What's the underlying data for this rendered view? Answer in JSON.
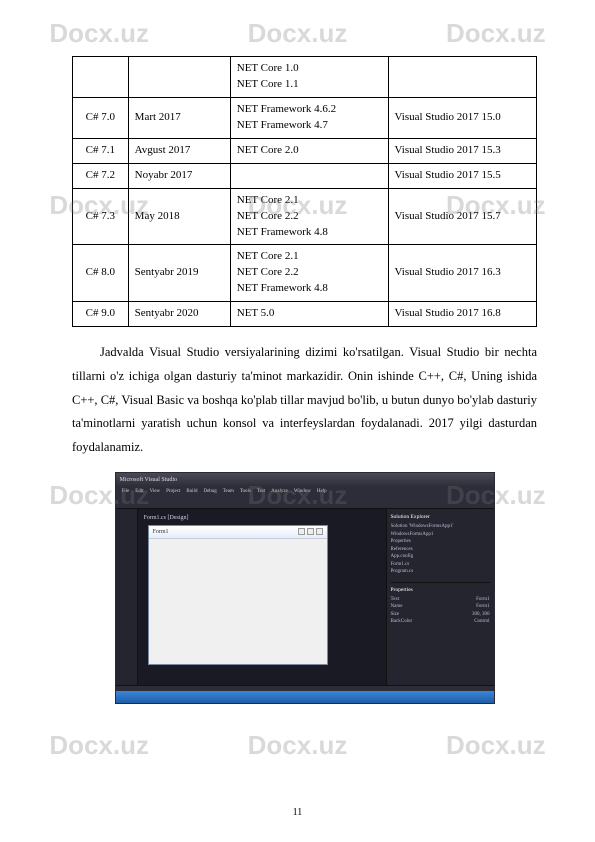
{
  "watermark": "Docx.uz",
  "table": {
    "rows": [
      {
        "ver": "",
        "date": "",
        "net": "NET Core 1.0\nNET Core 1.1",
        "vs": ""
      },
      {
        "ver": "C# 7.0",
        "date": "Mart 2017",
        "net": "NET Framework 4.6.2\nNET Framework 4.7",
        "vs": "Visual Studio 2017 15.0"
      },
      {
        "ver": "C# 7.1",
        "date": "Avgust 2017",
        "net": "NET Core 2.0",
        "vs": "Visual Studio 2017 15.3"
      },
      {
        "ver": "C# 7.2",
        "date": "Noyabr 2017",
        "net": "",
        "vs": "Visual Studio 2017 15.5"
      },
      {
        "ver": "C# 7.3",
        "date": "May 2018",
        "net": "NET Core 2.1\nNET Core 2.2\nNET Framework 4.8",
        "vs": "Visual Studio 2017 15.7"
      },
      {
        "ver": "C# 8.0",
        "date": "Sentyabr 2019",
        "net": "NET Core 2.1\nNET Core 2.2\nNET Framework 4.8",
        "vs": "Visual Studio 2017 16.3"
      },
      {
        "ver": "C# 9.0",
        "date": "Sentyabr 2020",
        "net": "NET 5.0",
        "vs": "Visual Studio 2017 16.8"
      }
    ]
  },
  "paragraph": "Jadvalda Visual Studio versiyalarining dizimi ko'rsatilgan. Visual Studio bir nechta tillarni o'z ichiga olgan dasturiy ta'minot markazidir. Onin ishinde C++, C#, Uning ishida C++, C#, Visual Basic va boshqa ko'plab tillar mavjud bo'lib, u butun dunyo bo'ylab dasturiy ta'minotlarni yaratish uchun konsol va interfeyslardan foydalanadi. 2017 yilgi dasturdan foydalanamiz.",
  "ide": {
    "title": "Microsoft Visual Studio",
    "menu": [
      "File",
      "Edit",
      "View",
      "Project",
      "Build",
      "Debug",
      "Team",
      "Tools",
      "Test",
      "Analyze",
      "Window",
      "Help"
    ],
    "tab": "Form1.cs [Design]",
    "form_title": "Form1",
    "solution_panel": {
      "title": "Solution Explorer",
      "items": [
        "Solution 'WindowsFormsApp1'",
        "WindowsFormsApp1",
        "Properties",
        "References",
        "App.config",
        "Form1.cs",
        "Program.cs"
      ]
    },
    "props_panel": {
      "title": "Properties",
      "rows": [
        [
          "Text",
          "Form1"
        ],
        [
          "Name",
          "Form1"
        ],
        [
          "Size",
          "300, 300"
        ],
        [
          "BackColor",
          "Control"
        ]
      ]
    }
  },
  "page_number": "11"
}
